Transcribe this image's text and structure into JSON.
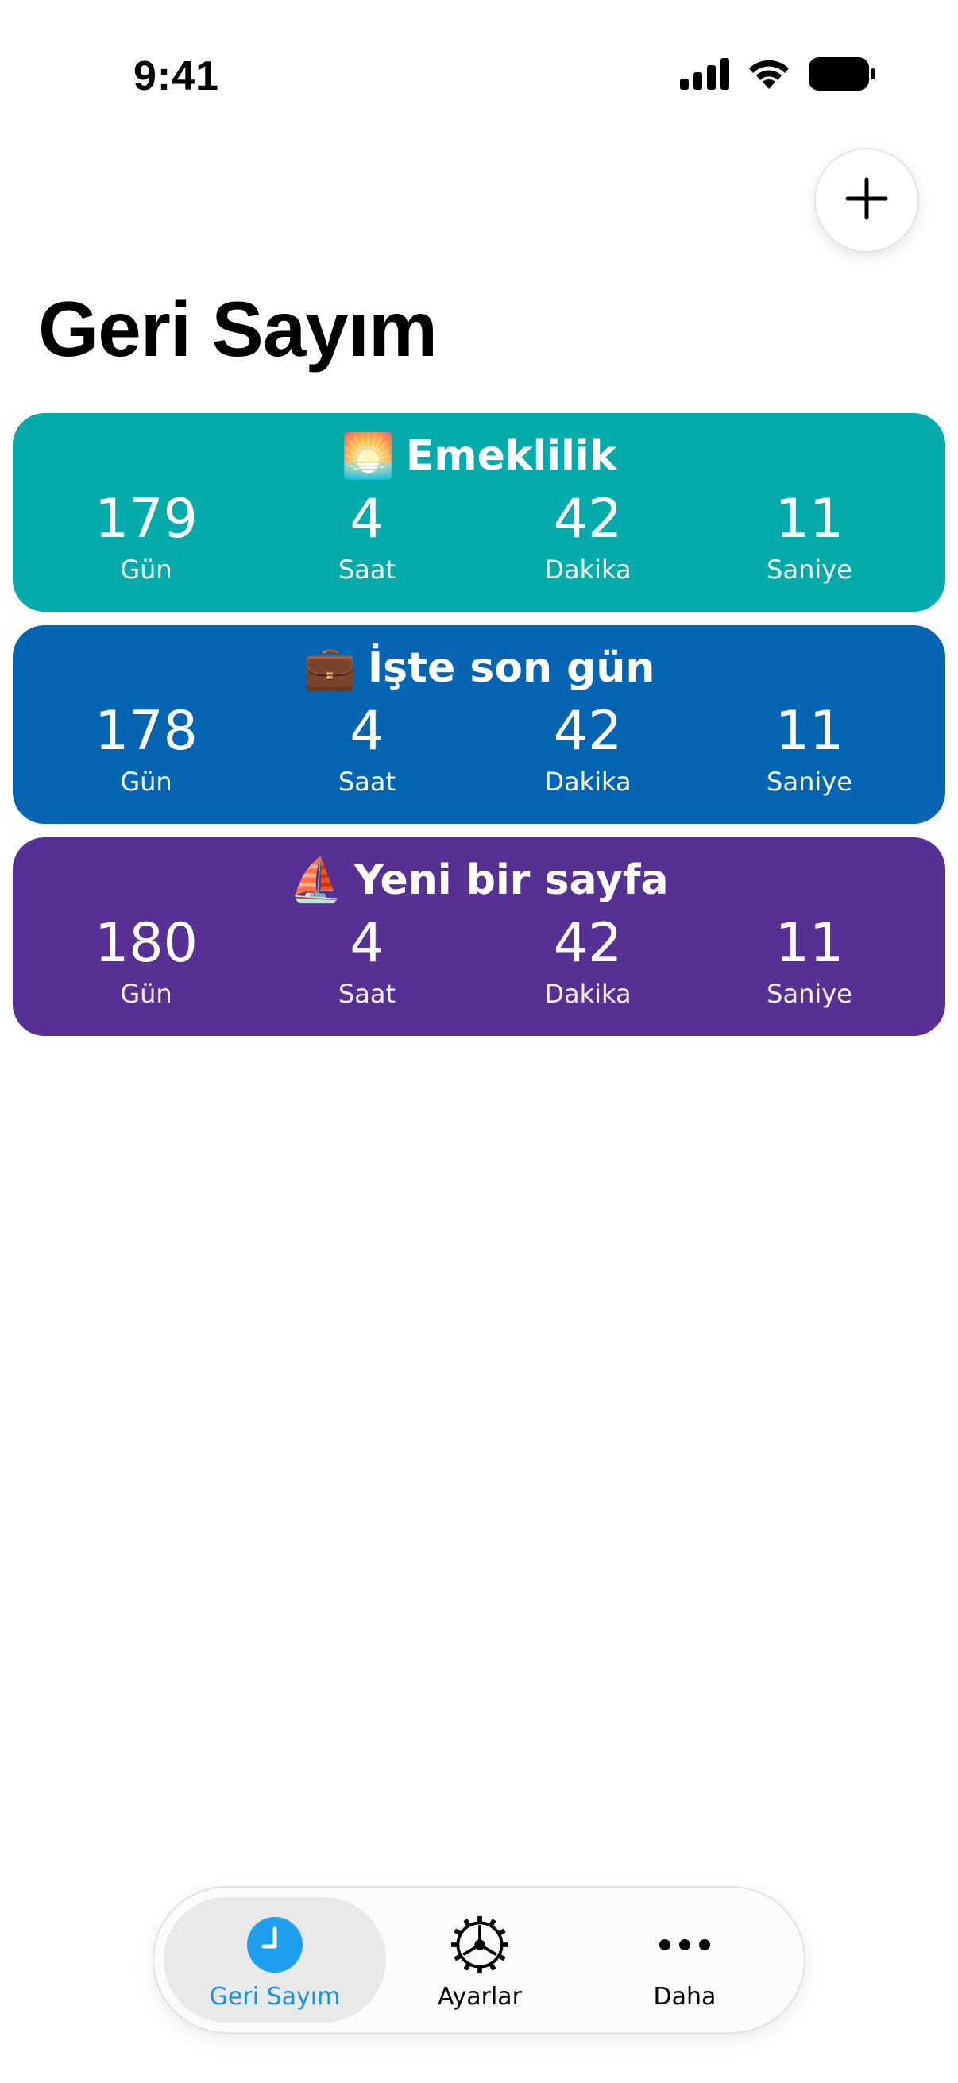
{
  "status_bar": {
    "time": "9:41"
  },
  "header": {
    "title": "Geri Sayım",
    "add_icon": "plus-icon"
  },
  "countdowns": [
    {
      "emoji": "🌅",
      "title": "Emeklilik",
      "color": "#05ABAB",
      "days": "179",
      "hours": "4",
      "minutes": "42",
      "seconds": "11"
    },
    {
      "emoji": "💼",
      "title": "İşte son gün",
      "color": "#0665B3",
      "days": "178",
      "hours": "4",
      "minutes": "42",
      "seconds": "11"
    },
    {
      "emoji": "⛵",
      "title": "Yeni bir sayfa",
      "color": "#573093",
      "days": "180",
      "hours": "4",
      "minutes": "42",
      "seconds": "11"
    }
  ],
  "unit_labels": {
    "days": "Gün",
    "hours": "Saat",
    "minutes": "Dakika",
    "seconds": "Saniye"
  },
  "tab_bar": {
    "tabs": [
      {
        "label": "Geri Sayım",
        "icon": "clock-icon",
        "active": true,
        "accent": "#1E9FEF"
      },
      {
        "label": "Ayarlar",
        "icon": "gear-icon",
        "active": false
      },
      {
        "label": "Daha",
        "icon": "ellipsis-icon",
        "active": false
      }
    ]
  }
}
